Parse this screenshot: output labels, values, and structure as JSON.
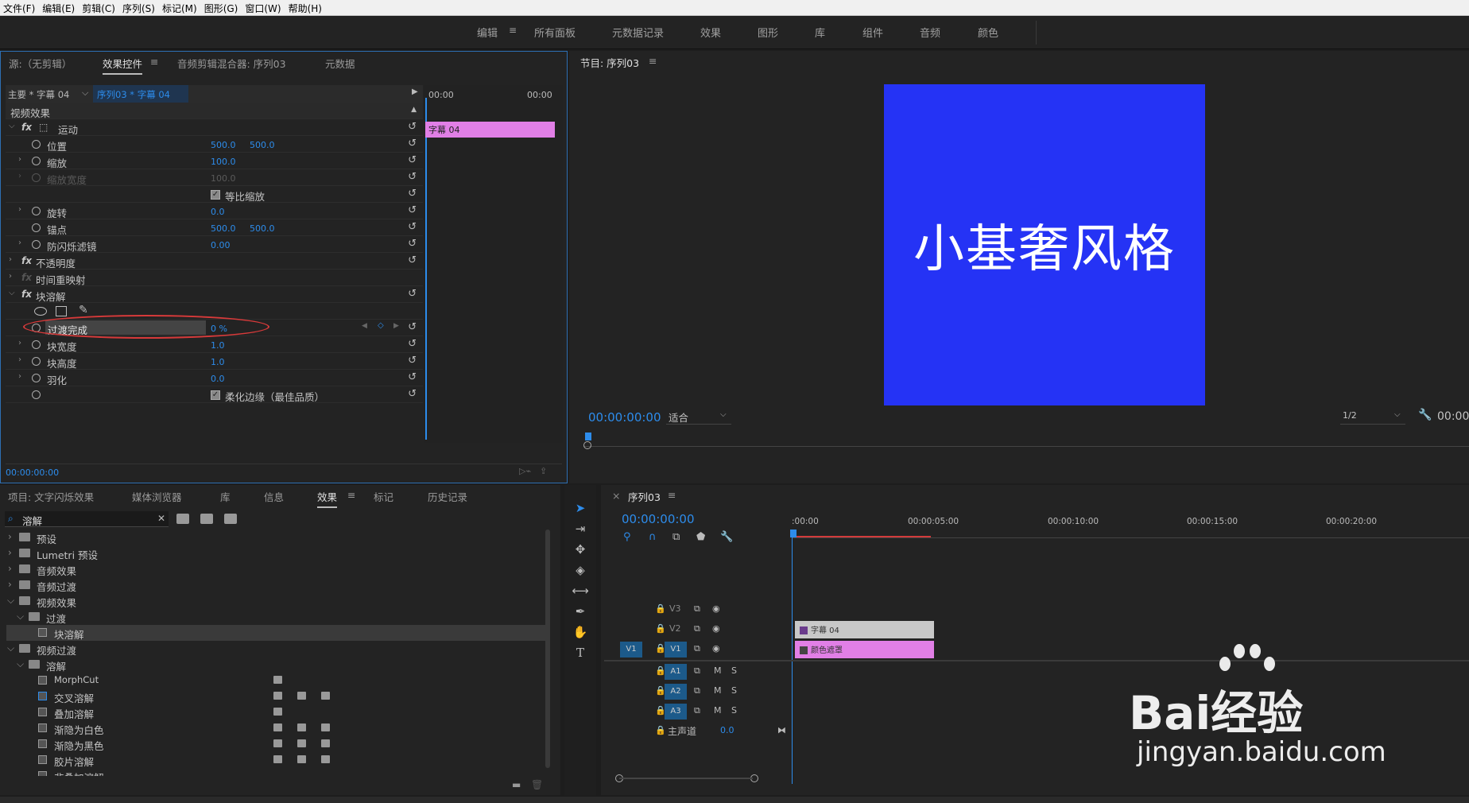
{
  "menu": [
    "文件(F)",
    "编辑(E)",
    "剪辑(C)",
    "序列(S)",
    "标记(M)",
    "图形(G)",
    "窗口(W)",
    "帮助(H)"
  ],
  "workspaces": [
    "编辑",
    "所有面板",
    "元数据记录",
    "效果",
    "图形",
    "库",
    "组件",
    "音频",
    "颜色"
  ],
  "effect_controls": {
    "tabs": [
      "源:（无剪辑）",
      "效果控件",
      "音频剪辑混合器: 序列03",
      "元数据"
    ],
    "master_clip": "主要 * 字幕 04",
    "seq_clip": "序列03 * 字幕 04",
    "time_start": "00:00",
    "time_end": "00:00",
    "clip_bar": "字幕 04",
    "section": "视频效果",
    "motion": "运动",
    "position": "位置",
    "pos_x": "500.0",
    "pos_y": "500.0",
    "scale": "缩放",
    "scale_v": "100.0",
    "scale_w": "缩放宽度",
    "scale_w_v": "100.0",
    "uniform": "等比缩放",
    "rotation": "旋转",
    "rotation_v": "0.0",
    "anchor": "锚点",
    "anchor_x": "500.0",
    "anchor_y": "500.0",
    "flicker": "防闪烁滤镜",
    "flicker_v": "0.00",
    "opacity": "不透明度",
    "timeremap": "时间重映射",
    "block": "块溶解",
    "transition": "过渡完成",
    "transition_v": "0 %",
    "block_w": "块宽度",
    "block_w_v": "1.0",
    "block_h": "块高度",
    "block_h_v": "1.0",
    "feather": "羽化",
    "feather_v": "0.0",
    "soft": "柔化边缘（最佳品质）",
    "timecode": "00:00:00:00"
  },
  "program": {
    "title": "节目: 序列03",
    "text": "小基奢风格",
    "timecode": "00:00:00:00",
    "fit": "适合",
    "quality": "1/2",
    "right_tc": "00:00",
    "bg_color": "#2533f5"
  },
  "project": {
    "tabs": [
      "项目: 文字闪烁效果",
      "媒体浏览器",
      "库",
      "信息",
      "效果",
      "标记",
      "历史记录"
    ],
    "search": "溶解",
    "tree": [
      {
        "label": "预设",
        "kind": "folder"
      },
      {
        "label": "Lumetri 预设",
        "kind": "folder"
      },
      {
        "label": "音频效果",
        "kind": "folder"
      },
      {
        "label": "音频过渡",
        "kind": "folder"
      },
      {
        "label": "视频效果",
        "kind": "folder"
      },
      {
        "label": "过渡",
        "kind": "folder"
      },
      {
        "label": "块溶解",
        "kind": "preset"
      },
      {
        "label": "视频过渡",
        "kind": "folder"
      },
      {
        "label": "溶解",
        "kind": "folder"
      },
      {
        "label": "MorphCut",
        "kind": "preset"
      },
      {
        "label": "交叉溶解",
        "kind": "preset"
      },
      {
        "label": "叠加溶解",
        "kind": "preset"
      },
      {
        "label": "渐隐为白色",
        "kind": "preset"
      },
      {
        "label": "渐隐为黑色",
        "kind": "preset"
      },
      {
        "label": "胶片溶解",
        "kind": "preset"
      },
      {
        "label": "非叠加溶解",
        "kind": "preset"
      }
    ]
  },
  "timeline": {
    "title": "序列03",
    "timecode": "00:00:00:00",
    "ruler": [
      ":00:00",
      "00:00:05:00",
      "00:00:10:00",
      "00:00:15:00",
      "00:00:20:00"
    ],
    "tracks": [
      "V3",
      "V2",
      "V1",
      "A1",
      "A2",
      "A3"
    ],
    "v_label": "V1",
    "master": "主声道",
    "master_v": "0.0",
    "clip_v2": "字幕 04",
    "clip_v1": "颜色遮罩",
    "mute": "M",
    "solo": "S"
  },
  "watermark": {
    "brand": "Bai经验",
    "url": "jingyan.baidu.com"
  }
}
